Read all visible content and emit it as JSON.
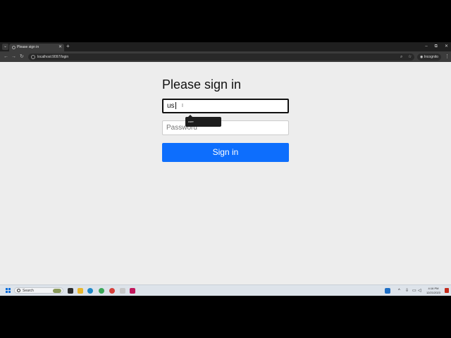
{
  "browser": {
    "tab_title": "Please sign in",
    "new_tab": "+",
    "url": "localhost:9097/login",
    "incognito_label": "Incognito",
    "window_controls": [
      "–",
      "⧉",
      "✕"
    ]
  },
  "page": {
    "heading": "Please sign in",
    "username_value": "us",
    "password_placeholder": "Password",
    "signin_label": "Sign in"
  },
  "autofill": {
    "suggestion": "user"
  },
  "taskbar": {
    "search_label": "Search",
    "time": "4:16 PM",
    "date": "12/21/2023"
  },
  "colors": {
    "primary_button": "#0d6efd",
    "page_background": "#ededed"
  }
}
